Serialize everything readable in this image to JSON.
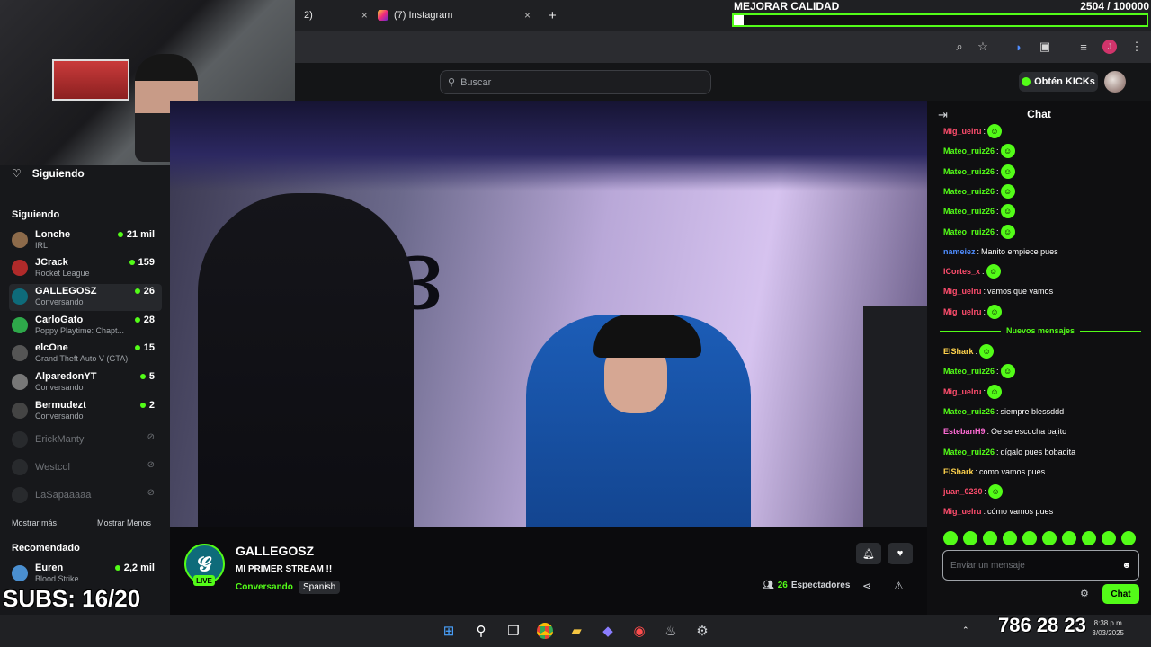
{
  "browser": {
    "tabs": [
      {
        "label": "2)",
        "close": "×"
      },
      {
        "label": "(7) Instagram",
        "close": "×"
      }
    ],
    "new_tab": "+"
  },
  "goal": {
    "title": "MEJORAR CALIDAD",
    "count": "2504 / 100000",
    "progress": 0.025
  },
  "header": {
    "search_placeholder": "Buscar",
    "kicks_button": "Obtén KICKs"
  },
  "sidebar": {
    "following_header": "Siguiendo",
    "section_label": "Siguiendo",
    "channels": [
      {
        "name": "Lonche",
        "sub": "IRL",
        "count": "21 mil"
      },
      {
        "name": "JCrack",
        "sub": "Rocket League",
        "count": "159"
      },
      {
        "name": "GALLEGOSZ",
        "sub": "Conversando",
        "count": "26"
      },
      {
        "name": "CarloGato",
        "sub": "Poppy Playtime: Chapt...",
        "count": "28"
      },
      {
        "name": "elcOne",
        "sub": "Grand Theft Auto V (GTA)",
        "count": "15"
      },
      {
        "name": "AlparedonYT",
        "sub": "Conversando",
        "count": "5"
      },
      {
        "name": "Bermudezt",
        "sub": "Conversando",
        "count": "2"
      }
    ],
    "offline": [
      "ErickManty",
      "Westcol",
      "LaSapaaaaa"
    ],
    "show_more": "Mostrar más",
    "show_less": "Mostrar Menos",
    "recommended_label": "Recomendado",
    "recommended": [
      {
        "name": "Euren",
        "sub": "Blood Strike",
        "count": "2,2 mil"
      }
    ]
  },
  "stream": {
    "channel": "GALLEGOSZ",
    "title": "MI PRIMER STREAM !!",
    "category": "Conversando",
    "language": "Spanish",
    "live_badge": "LIVE",
    "viewers_count": "26",
    "viewers_label": "Espectadores"
  },
  "chat": {
    "title": "Chat",
    "messages_top": [
      {
        "user": "Mig_uelru",
        "text": "",
        "color": "#ff4d6d"
      },
      {
        "user": "Mateo_ruiz26",
        "text": "",
        "color": "#53fc18"
      },
      {
        "user": "Mateo_ruiz26",
        "text": "",
        "color": "#53fc18"
      },
      {
        "user": "Mateo_ruiz26",
        "text": "",
        "color": "#53fc18"
      },
      {
        "user": "Mateo_ruiz26",
        "text": "",
        "color": "#53fc18"
      },
      {
        "user": "Mateo_ruiz26",
        "text": "",
        "color": "#53fc18"
      },
      {
        "user": "nameiez",
        "text": "Manito empiece pues",
        "color": "#4f8dff"
      },
      {
        "user": "ICortes_x",
        "text": "",
        "color": "#ff4d6d"
      },
      {
        "user": "Mig_uelru",
        "text": "vamos que vamos",
        "color": "#ff4d6d"
      },
      {
        "user": "Mig_uelru",
        "text": "",
        "color": "#ff4d6d"
      }
    ],
    "new_messages_label": "Nuevos mensajes",
    "messages_bottom": [
      {
        "user": "ElShark",
        "text": "",
        "color": "#ffd34d"
      },
      {
        "user": "Mateo_ruiz26",
        "text": "",
        "color": "#53fc18"
      },
      {
        "user": "Mig_uelru",
        "text": "",
        "color": "#ff4d6d"
      },
      {
        "user": "Mateo_ruiz26",
        "text": "siempre blessddd",
        "color": "#53fc18"
      },
      {
        "user": "EstebanH9",
        "text": "Oe se escucha bajito",
        "color": "#ff6bd6"
      },
      {
        "user": "Mateo_ruiz26",
        "text": "dígalo pues bobadita",
        "color": "#53fc18"
      },
      {
        "user": "ElShark",
        "text": "como vamos pues",
        "color": "#ffd34d"
      },
      {
        "user": "juan_0230",
        "text": "",
        "color": "#ff4d6d"
      },
      {
        "user": "Mig_uelru",
        "text": "cómo vamos pues",
        "color": "#ff4d6d"
      }
    ],
    "input_placeholder": "Enviar un mensaje",
    "send_label": "Chat"
  },
  "overlays": {
    "subs": "SUBS: 16/20",
    "counter": "786 28 23"
  },
  "taskbar": {
    "time": "8:38 p.m.",
    "date": "3/03/2025"
  }
}
